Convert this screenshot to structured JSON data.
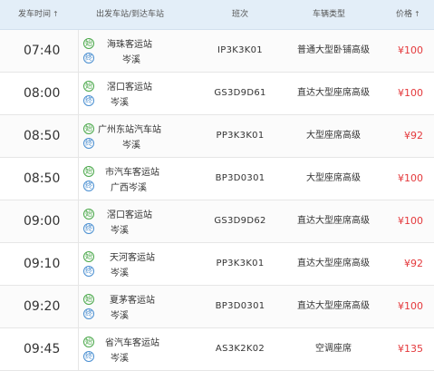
{
  "header": {
    "time": "发车时间",
    "time_sort": "↑",
    "station": "出发车站/到达车站",
    "number": "班次",
    "type": "车辆类型",
    "price": "价格",
    "price_sort": "↑"
  },
  "labels": {
    "from_badge": "始",
    "to_badge": "终"
  },
  "rows": [
    {
      "time": "07:40",
      "from": "海珠客运站",
      "to": "岑溪",
      "number": "IP3K3K01",
      "type": "普通大型卧铺高级",
      "price": "¥100"
    },
    {
      "time": "08:00",
      "from": "滘口客运站",
      "to": "岑溪",
      "number": "GS3D9D61",
      "type": "直达大型座席高级",
      "price": "¥100"
    },
    {
      "time": "08:50",
      "from": "广州东站汽车站",
      "to": "岑溪",
      "number": "PP3K3K01",
      "type": "大型座席高级",
      "price": "¥92"
    },
    {
      "time": "08:50",
      "from": "市汽车客运站",
      "to": "广西岑溪",
      "number": "BP3D0301",
      "type": "大型座席高级",
      "price": "¥100"
    },
    {
      "time": "09:00",
      "from": "滘口客运站",
      "to": "岑溪",
      "number": "GS3D9D62",
      "type": "直达大型座席高级",
      "price": "¥100"
    },
    {
      "time": "09:10",
      "from": "天河客运站",
      "to": "岑溪",
      "number": "PP3K3K01",
      "type": "直达大型座席高级",
      "price": "¥92"
    },
    {
      "time": "09:20",
      "from": "夏茅客运站",
      "to": "岑溪",
      "number": "BP3D0301",
      "type": "直达大型座席高级",
      "price": "¥100"
    },
    {
      "time": "09:45",
      "from": "省汽车客运站",
      "to": "岑溪",
      "number": "AS3K2K02",
      "type": "空调座席",
      "price": "¥135"
    }
  ],
  "colors": {
    "header_bg": "#e3eef8",
    "price": "#e4393c",
    "from_badge": "#4aa84a",
    "to_badge": "#4a8fd1"
  }
}
